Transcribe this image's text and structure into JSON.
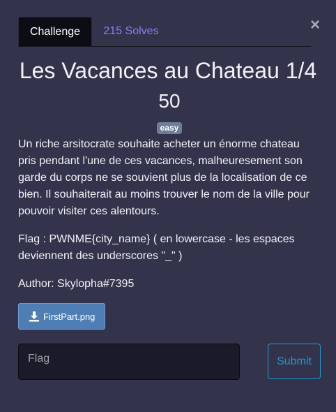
{
  "modal": {
    "close_label": "×"
  },
  "tabs": [
    {
      "label": "Challenge"
    },
    {
      "label": "215 Solves"
    }
  ],
  "challenge": {
    "title": "Les Vacances au Chateau 1/4",
    "points": "50",
    "difficulty": "easy",
    "description": "Un riche arsitocrate souhaite acheter un énorme chateau pris pendant l'une de ces vacances, malheuresement son garde du corps ne se souvient plus de la localisation de ce bien. Il souhaiterait au moins trouver le nom de la ville pour pouvoir visiter ces alentours.",
    "flag_format": "Flag : PWNME{city_name} ( en lowercase - les espaces deviennent des underscores \"_\" )",
    "author": "Author: Skylopha#7395"
  },
  "file": {
    "name": "FirstPart.png",
    "icon": "download-icon"
  },
  "submission": {
    "placeholder": "Flag",
    "value": "",
    "submit_label": "Submit"
  },
  "colors": {
    "background": "#33334c",
    "tab_active_bg": "#0c0c14",
    "tab_inactive_text": "#8b7df0",
    "badge_bg": "#6c7f96",
    "file_button_bg": "#4f7eb4",
    "submit_accent": "#1e9ad1"
  }
}
